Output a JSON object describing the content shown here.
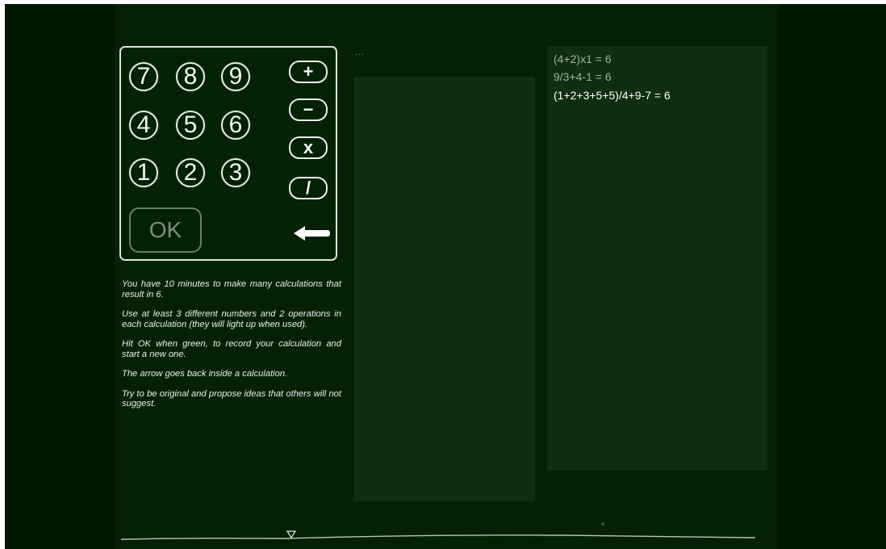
{
  "keypad": {
    "digits": [
      "7",
      "8",
      "9",
      "4",
      "5",
      "6",
      "1",
      "2",
      "3"
    ],
    "operations": [
      "+",
      "−",
      "x",
      "/"
    ],
    "ok_label": "OK"
  },
  "instructions": [
    "You have 10 minutes to make many calculations that result in 6.",
    "Use at least 3 different numbers and 2 operations in each calculation (they will light up when used).",
    "Hit OK when green, to record your calculation and start a new one.",
    "The arrow goes back inside a calculation.",
    "Try to be original and propose ideas that others will not suggest."
  ],
  "work_indicator": "...",
  "results": [
    {
      "text": "(4+2)x1 = 6",
      "color": "#9fb19f"
    },
    {
      "text": "9/3+4-1 = 6",
      "color": "#9fb19f"
    },
    {
      "text": "(1+2+3+5+5)/4+9-7 = 6",
      "color": "#ffffff"
    }
  ],
  "colors": {
    "background": "#001700",
    "stage": "#042104",
    "panel": "#0f2f10",
    "ok_inactive": "#7b8f7b"
  },
  "icons": {
    "backspace": "left-arrow-icon",
    "timeline_marker": "triangle-down-icon"
  }
}
